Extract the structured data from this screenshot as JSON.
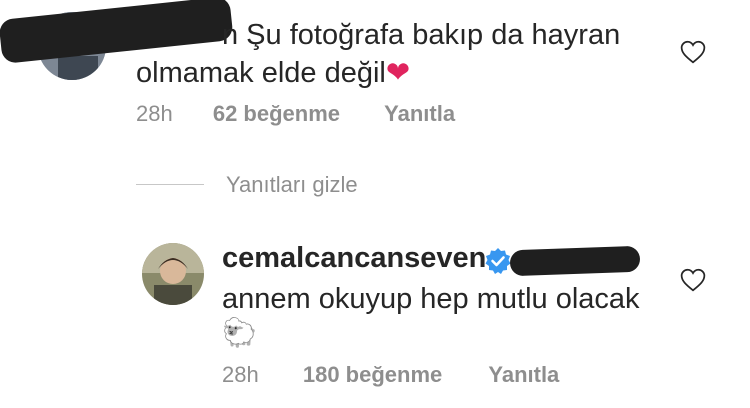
{
  "comments": [
    {
      "text_line1": "n Şu fotoğrafa bakıp da hayran",
      "text_line2": "olmamak elde değil",
      "emoji": "❤",
      "time": "28h",
      "likes": "62 beğenme",
      "reply": "Yanıtla"
    }
  ],
  "replies_toggle": "Yanıtları gizle",
  "reply_comment": {
    "username": "cemalcancanseven",
    "text": "annem okuyup hep mutlu olacak",
    "emoji": "🐑",
    "time": "28h",
    "likes": "180 beğenme",
    "reply": "Yanıtla"
  },
  "colors": {
    "verified": "#3897f0",
    "heart": "#e0245e",
    "meta": "#8e8e8e"
  }
}
